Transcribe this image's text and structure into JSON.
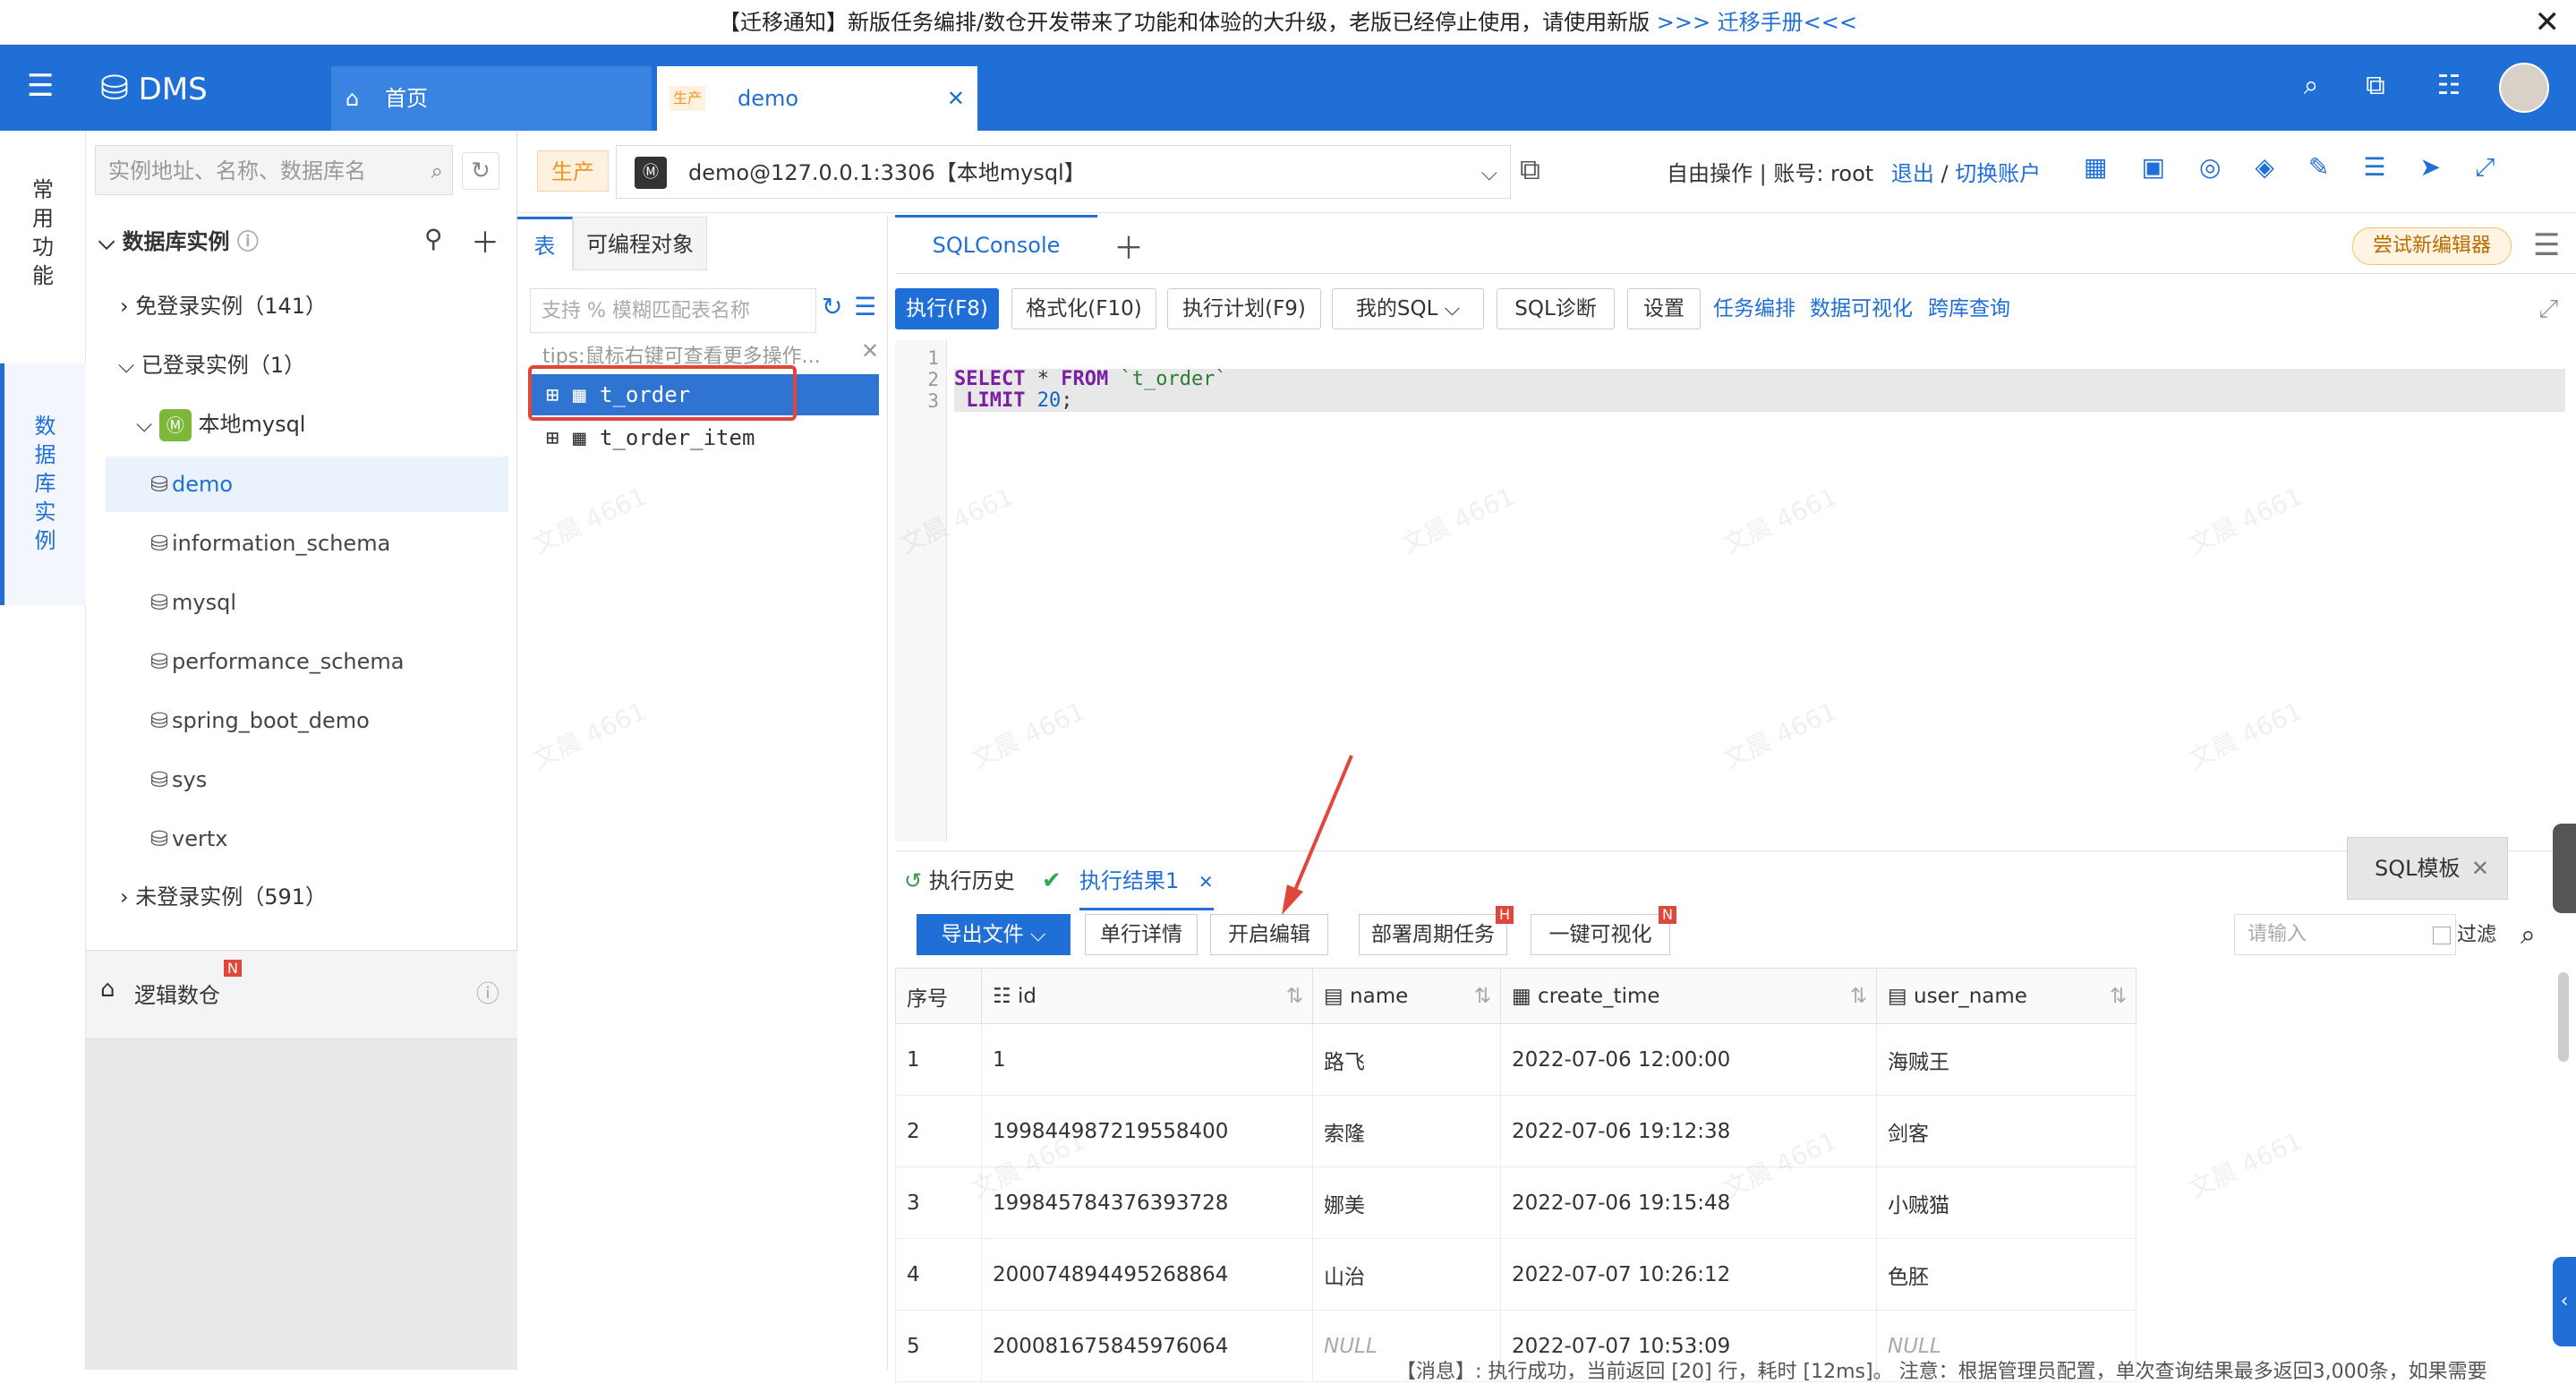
{
  "notice": {
    "text": "【迁移通知】新版任务编排/数仓开发带来了功能和体验的大升级，老版已经停止使用，请使用新版",
    "link": ">>> 迁移手册<<<"
  },
  "topbar": {
    "app": "DMS",
    "tab1": "首页",
    "tab2_badge": "生产",
    "tab2": "demo"
  },
  "rail": {
    "item1": [
      "常",
      "用",
      "功",
      "能"
    ],
    "item2": [
      "数",
      "据",
      "库",
      "实",
      "例"
    ]
  },
  "sidebar": {
    "search_placeholder": "实例地址、名称、数据库名",
    "section": "数据库实例",
    "groups": {
      "free": "免登录实例（141）",
      "logged": "已登录实例（1）",
      "instance": "本地mysql",
      "not_logged": "未登录实例（591）"
    },
    "dbs": [
      "demo",
      "information_schema",
      "mysql",
      "performance_schema",
      "spring_boot_demo",
      "sys",
      "vertx"
    ],
    "logic": "逻辑数仓",
    "logic_badge": "N"
  },
  "conn": {
    "env": "生产",
    "target": "demo@127.0.0.1:3306【本地mysql】",
    "mode": "自由操作 | 账号: root",
    "logout": "退出",
    "switch": "切换账户"
  },
  "tables": {
    "tab_table": "表",
    "tab_prog": "可编程对象",
    "filter_placeholder": "支持 % 模糊匹配表名称",
    "tips": "tips:鼠标右键可查看更多操作...",
    "items": [
      "t_order",
      "t_order_item"
    ]
  },
  "editor": {
    "tab": "SQLConsole",
    "try": "尝试新编辑器",
    "buttons": {
      "run": "执行(F8)",
      "format": "格式化(F10)",
      "plan": "执行计划(F9)",
      "mysql": "我的SQL",
      "diag": "SQL诊断",
      "settings": "设置"
    },
    "links": {
      "task": "任务编排",
      "viz": "数据可视化",
      "cross": "跨库查询"
    },
    "lines": [
      "1",
      "2",
      "3"
    ]
  },
  "results": {
    "history": "执行历史",
    "result_tab": "执行结果1",
    "buttons": {
      "export": "导出文件",
      "detail": "单行详情",
      "edit": "开启编辑",
      "deploy": "部署周期任务",
      "viz": "一键可视化"
    },
    "badge": {
      "h": "H",
      "n": "N"
    },
    "search_placeholder": "请输入",
    "filter": "过滤",
    "columns": [
      "序号",
      "id",
      "name",
      "create_time",
      "user_name"
    ],
    "rows": [
      [
        "1",
        "1",
        "路飞",
        "2022-07-06 12:00:00",
        "海贼王"
      ],
      [
        "2",
        "199844987219558400",
        "索隆",
        "2022-07-06 19:12:38",
        "剑客"
      ],
      [
        "3",
        "199845784376393728",
        "娜美",
        "2022-07-06 19:15:48",
        "小贼猫"
      ],
      [
        "4",
        "200074894495268864",
        "山治",
        "2022-07-07 10:26:12",
        "色胚"
      ],
      [
        "5",
        "200081675845976064",
        "NULL",
        "2022-07-07 10:53:09",
        "NULL"
      ]
    ],
    "template": "SQL模板"
  },
  "statusline": "【消息】: 执行成功，当前返回 [20] 行，耗时 [12ms]。 注意：根据管理员配置，单次查询结果最多返回3,000条，如果需要",
  "watermark": "文晨 4661"
}
